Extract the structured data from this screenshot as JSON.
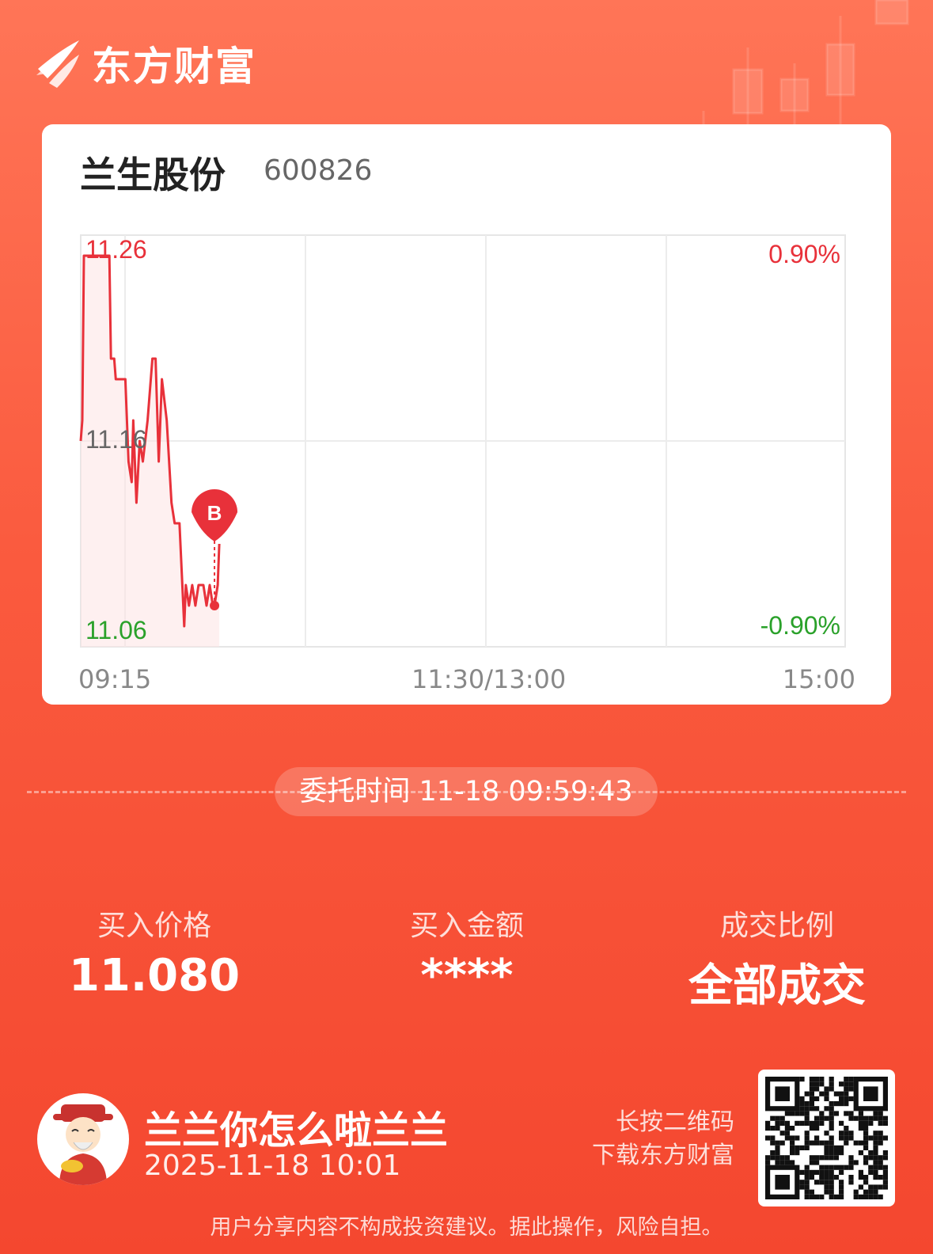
{
  "brand": {
    "name": "东方财富",
    "logo_icon": "eastmoney-logo-icon"
  },
  "stock": {
    "name": "兰生股份",
    "code": "600826"
  },
  "chart_data": {
    "type": "line",
    "title": "",
    "price_labels": {
      "high": "11.26",
      "mid": "11.16",
      "low": "11.06"
    },
    "pct_labels": {
      "high": "0.90%",
      "low": "-0.90%"
    },
    "x_tick_labels": [
      "09:15",
      "11:30/13:00",
      "15:00"
    ],
    "ylim": [
      11.06,
      11.26
    ],
    "session_minutes": 240,
    "grid": true,
    "series": [
      {
        "color": "#e8313a",
        "points": [
          [
            0,
            11.16
          ],
          [
            0.5,
            11.17
          ],
          [
            1,
            11.25
          ],
          [
            2,
            11.25
          ],
          [
            3,
            11.25
          ],
          [
            4,
            11.25
          ],
          [
            5,
            11.25
          ],
          [
            6,
            11.25
          ],
          [
            7,
            11.25
          ],
          [
            8,
            11.25
          ],
          [
            9,
            11.25
          ],
          [
            9.5,
            11.2
          ],
          [
            10.5,
            11.2
          ],
          [
            11,
            11.19
          ],
          [
            12.5,
            11.19
          ],
          [
            14,
            11.19
          ],
          [
            14.5,
            11.17
          ],
          [
            15,
            11.15
          ],
          [
            16,
            11.14
          ],
          [
            16.5,
            11.17
          ],
          [
            17.5,
            11.13
          ],
          [
            18.5,
            11.16
          ],
          [
            19.5,
            11.15
          ],
          [
            21,
            11.17
          ],
          [
            22.5,
            11.2
          ],
          [
            23.5,
            11.2
          ],
          [
            24.5,
            11.15
          ],
          [
            25.5,
            11.19
          ],
          [
            27,
            11.17
          ],
          [
            28.5,
            11.13
          ],
          [
            29.5,
            11.12
          ],
          [
            31,
            11.12
          ],
          [
            32.5,
            11.07
          ],
          [
            33,
            11.09
          ],
          [
            34,
            11.08
          ],
          [
            35,
            11.09
          ],
          [
            36,
            11.08
          ],
          [
            37,
            11.09
          ],
          [
            38.5,
            11.09
          ],
          [
            39.5,
            11.08
          ],
          [
            40.5,
            11.09
          ],
          [
            41.5,
            11.08
          ],
          [
            42,
            11.08
          ],
          [
            43,
            11.09
          ],
          [
            43.5,
            11.11
          ]
        ]
      }
    ],
    "buy_marker": {
      "label": "B",
      "time_min": 42,
      "price": 11.08,
      "color": "#e8313a"
    }
  },
  "order_time": "委托时间 11-18 09:59:43",
  "stats": [
    {
      "label": "买入价格",
      "value": "11.080"
    },
    {
      "label": "买入金额",
      "value": "****"
    },
    {
      "label": "成交比例",
      "value": "全部成交"
    }
  ],
  "user": {
    "name": "兰兰你怎么啦兰兰",
    "time": "2025-11-18 10:01",
    "avatar_icon": "caishen-avatar-icon"
  },
  "qr": {
    "hint_line1": "长按二维码",
    "hint_line2": "下载东方财富",
    "icon": "qr-code-icon"
  },
  "disclaimer": "用户分享内容不构成投资建议。据此操作，风险自担。"
}
